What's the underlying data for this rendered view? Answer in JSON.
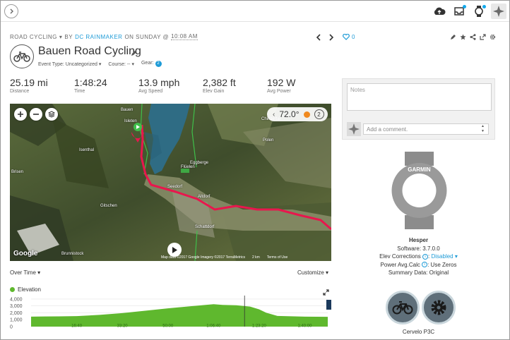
{
  "header": {
    "breadcrumb_type": "ROAD CYCLING",
    "breadcrumb_by": "BY",
    "breadcrumb_author": "DC RAINMAKER",
    "breadcrumb_on": "ON SUNDAY @",
    "breadcrumb_time": "10:08 AM",
    "title": "Bauen Road Cycling",
    "event_type": "Event Type: Uncategorized",
    "course": "Course: --",
    "gear_label": "Gear:",
    "gear_count": "2",
    "likes": "0"
  },
  "stats": [
    {
      "value": "25.19 mi",
      "label": "Distance"
    },
    {
      "value": "1:48:24",
      "label": "Time"
    },
    {
      "value": "13.9 mph",
      "label": "Avg Speed"
    },
    {
      "value": "2,382 ft",
      "label": "Elev Gain"
    },
    {
      "value": "192 W",
      "label": "Avg Power"
    }
  ],
  "map": {
    "weather_temp": "72.0°",
    "weather_count": "2",
    "attribution": "Map data ©2017 Google Imagery ©2017 TerraMetrics",
    "scale": "2 km",
    "terms": "Terms of Use",
    "logo": "Google",
    "places": [
      "Bauen",
      "Isleten",
      "Isenthal",
      "Flüelen",
      "Eggberge",
      "Seedorf",
      "Altdorf",
      "Schattdorf",
      "Gitschen",
      "Brisen",
      "Brunnistock",
      "Polen",
      "Chinzertal"
    ]
  },
  "chart": {
    "over_time_label": "Over Time",
    "customize_label": "Customize",
    "legend_label": "Elevation"
  },
  "chart_data": {
    "type": "area",
    "title": "",
    "xlabel": "",
    "ylabel": "",
    "x_ticks": [
      "16:40",
      "33:20",
      "50:00",
      "1:06:40",
      "1:23:20",
      "1:40:00"
    ],
    "y_ticks": [
      "0",
      "1,000",
      "2,000",
      "3,000",
      "4,000"
    ],
    "ylim": [
      0,
      4500
    ],
    "series": [
      {
        "name": "Elevation",
        "x_minutes": [
          0,
          5,
          10,
          16.7,
          25,
          33.3,
          41.7,
          50,
          58.3,
          66.7,
          70,
          75,
          80,
          83.3,
          86,
          90,
          95,
          100,
          108.4
        ],
        "values": [
          1450,
          1470,
          1480,
          1520,
          1700,
          1950,
          2300,
          2650,
          2950,
          3250,
          3150,
          3100,
          2900,
          2500,
          2000,
          1550,
          1500,
          1450,
          1420
        ]
      }
    ],
    "grid": true,
    "colors": {
      "fill": "#5fb82e"
    }
  },
  "notes": {
    "placeholder": "Notes",
    "comment_placeholder": "Add a comment."
  },
  "device": {
    "brand": "GARMIN",
    "name": "Hesper",
    "software": "Software: 3.7.0.0",
    "elev_corrections_label": "Elev Corrections",
    "elev_corrections_value": "Disabled",
    "power_avg_label": "Power Avg.Calc",
    "power_avg_value": "Use Zeros",
    "summary": "Summary Data: Original"
  },
  "gear": {
    "name": "Cervelo P3C"
  },
  "colors": {
    "accent": "#1e9bd7",
    "route": "#e8174d",
    "elevation": "#5fb82e"
  }
}
